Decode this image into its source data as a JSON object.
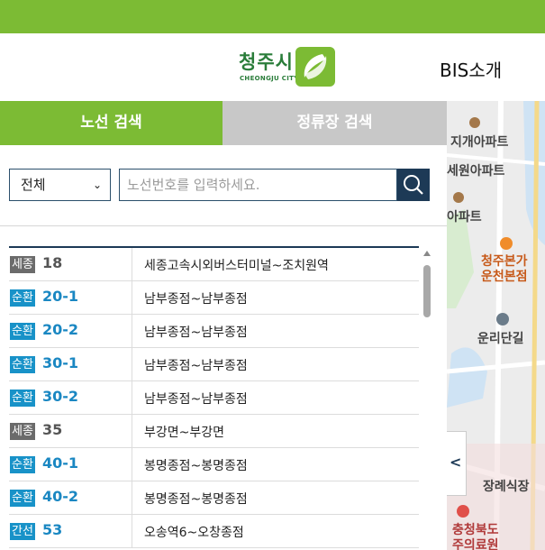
{
  "header": {
    "logo_text": "청주시",
    "logo_sub": "CHEONGJU CITY",
    "bis_link": "BIS소개"
  },
  "tabs": [
    {
      "label": "노선 검색",
      "active": true
    },
    {
      "label": "정류장 검색",
      "active": false
    }
  ],
  "search": {
    "select_value": "전체",
    "input_value": "",
    "placeholder": "노선번호를 입력하세요."
  },
  "routes": [
    {
      "type": "세종",
      "number": "18",
      "name": "세종고속시외버스터미널~조치원역",
      "color": "gray"
    },
    {
      "type": "순환",
      "number": "20-1",
      "name": "남부종점~남부종점",
      "color": "teal"
    },
    {
      "type": "순환",
      "number": "20-2",
      "name": "남부종점~남부종점",
      "color": "teal"
    },
    {
      "type": "순환",
      "number": "30-1",
      "name": "남부종점~남부종점",
      "color": "teal"
    },
    {
      "type": "순환",
      "number": "30-2",
      "name": "남부종점~남부종점",
      "color": "teal"
    },
    {
      "type": "세종",
      "number": "35",
      "name": "부강면~부강면",
      "color": "gray"
    },
    {
      "type": "순환",
      "number": "40-1",
      "name": "봉명종점~봉명종점",
      "color": "teal"
    },
    {
      "type": "순환",
      "number": "40-2",
      "name": "봉명종점~봉명종점",
      "color": "teal"
    },
    {
      "type": "간선",
      "number": "53",
      "name": "오송역6~오창종점",
      "color": "teal"
    }
  ],
  "map": {
    "labels": [
      {
        "text": "지개아파트"
      },
      {
        "text": "세원아파트"
      },
      {
        "text": "아파트"
      },
      {
        "text": "청주본가"
      },
      {
        "text": "운천본점"
      },
      {
        "text": "운리단길"
      },
      {
        "text": "장례식장"
      },
      {
        "text": "충청북도"
      },
      {
        "text": "주의료원"
      }
    ]
  },
  "colors": {
    "brand_green": "#7cbb34",
    "navy": "#1d3a56",
    "teal_badge": "#1892c8",
    "gray_badge": "#6b6b6b"
  }
}
